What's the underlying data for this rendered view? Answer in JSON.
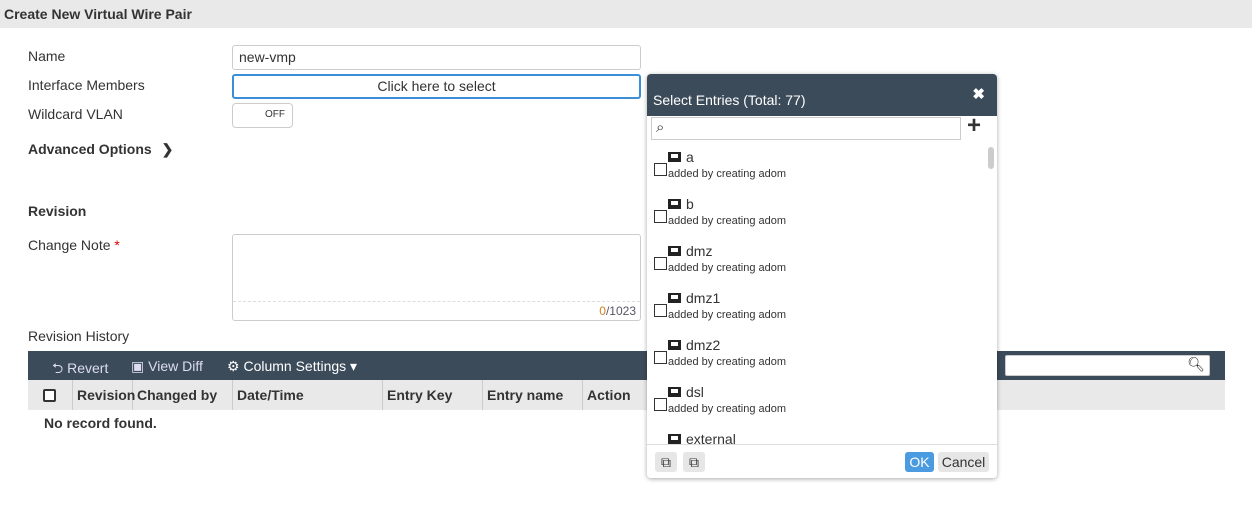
{
  "title": "Create New Virtual Wire Pair",
  "form": {
    "name_label": "Name",
    "name_value": "new-vmp",
    "members_label": "Interface Members",
    "members_placeholder": "Click here to select",
    "wildcard_label": "Wildcard VLAN",
    "wildcard_state": "OFF",
    "advanced_label": "Advanced Options",
    "revision_heading": "Revision",
    "change_note_label": "Change Note",
    "required_mark": "*",
    "char_count": "0",
    "char_max": "/1023",
    "history_label": "Revision History"
  },
  "toolbar": {
    "revert": "Revert",
    "view_diff": "View Diff",
    "column_settings": "Column Settings"
  },
  "table": {
    "columns": [
      "Revision",
      "Changed by",
      "Date/Time",
      "Entry Key",
      "Entry name",
      "Action"
    ],
    "empty": "No record found."
  },
  "dialog": {
    "title": "Select Entries (Total: 77)",
    "ok": "OK",
    "cancel": "Cancel",
    "items": [
      {
        "name": "a",
        "sub": "added by creating adom"
      },
      {
        "name": "b",
        "sub": "added by creating adom"
      },
      {
        "name": "dmz",
        "sub": "added by creating adom"
      },
      {
        "name": "dmz1",
        "sub": "added by creating adom"
      },
      {
        "name": "dmz2",
        "sub": "added by creating adom"
      },
      {
        "name": "dsl",
        "sub": "added by creating adom"
      },
      {
        "name": "external",
        "sub": ""
      }
    ]
  }
}
